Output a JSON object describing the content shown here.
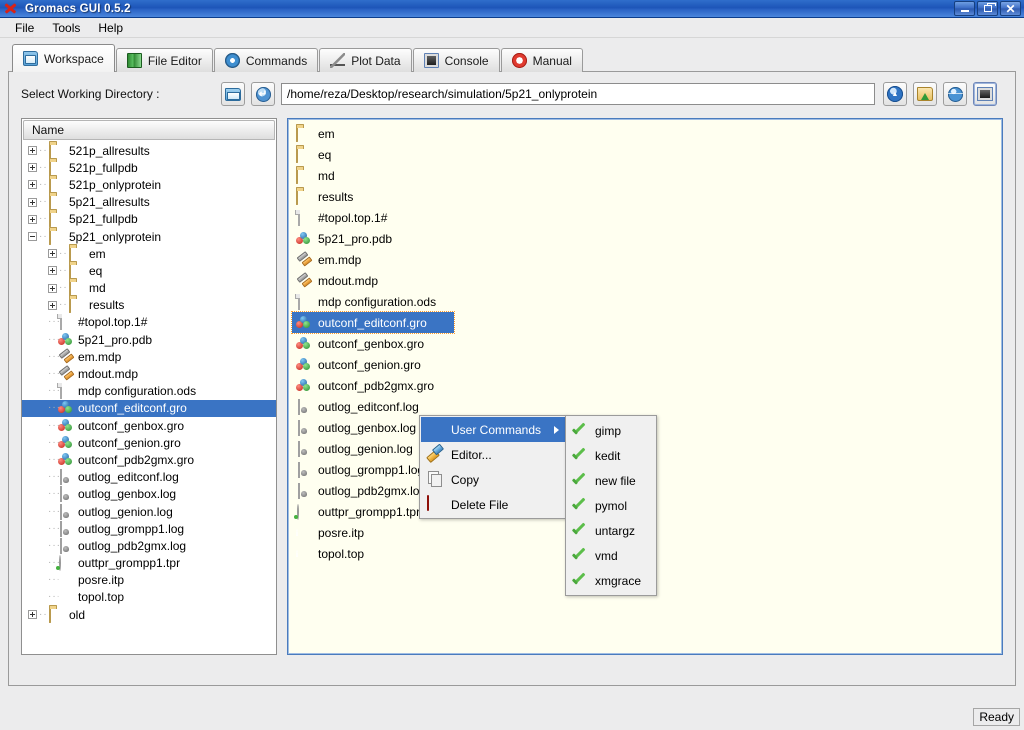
{
  "window": {
    "title": "Gromacs GUI 0.5.2",
    "logo_icon": "red-x-logo-icon",
    "controls": {
      "minimize": "minimize-button",
      "restore": "restore-button",
      "close": "close-button"
    }
  },
  "menubar": {
    "items": [
      {
        "label": "File"
      },
      {
        "label": "Tools"
      },
      {
        "label": "Help"
      }
    ]
  },
  "tabs": [
    {
      "label": "Workspace",
      "icon": "workspace-icon",
      "active": true
    },
    {
      "label": "File Editor",
      "icon": "file-editor-icon",
      "active": false
    },
    {
      "label": "Commands",
      "icon": "commands-gear-icon",
      "active": false
    },
    {
      "label": "Plot Data",
      "icon": "plot-data-icon",
      "active": false
    },
    {
      "label": "Console",
      "icon": "console-icon",
      "active": false
    },
    {
      "label": "Manual",
      "icon": "manual-lifering-icon",
      "active": false
    }
  ],
  "directory": {
    "label": "Select Working Directory :",
    "browse_icon": "open-folder-icon",
    "refresh_icon": "refresh-icon",
    "path": "/home/reza/Desktop/research/simulation/5p21_onlyprotein",
    "path_placeholder": "",
    "actions": [
      {
        "icon": "globe-up-icon"
      },
      {
        "icon": "folder-green-arrow-icon"
      },
      {
        "icon": "globe-icon"
      },
      {
        "icon": "terminal-icon"
      }
    ]
  },
  "tree": {
    "header": "Name",
    "items": [
      {
        "label": "521p_allresults",
        "depth": 0,
        "icon": "folder",
        "expander": "plus",
        "selected": false
      },
      {
        "label": "521p_fullpdb",
        "depth": 0,
        "icon": "folder",
        "expander": "plus",
        "selected": false
      },
      {
        "label": "521p_onlyprotein",
        "depth": 0,
        "icon": "folder",
        "expander": "plus",
        "selected": false
      },
      {
        "label": "5p21_allresults",
        "depth": 0,
        "icon": "folder",
        "expander": "plus",
        "selected": false
      },
      {
        "label": "5p21_fullpdb",
        "depth": 0,
        "icon": "folder",
        "expander": "plus",
        "selected": false
      },
      {
        "label": "5p21_onlyprotein",
        "depth": 0,
        "icon": "folder",
        "expander": "minus",
        "selected": false
      },
      {
        "label": "em",
        "depth": 1,
        "icon": "folder",
        "expander": "plus",
        "selected": false
      },
      {
        "label": "eq",
        "depth": 1,
        "icon": "folder",
        "expander": "plus",
        "selected": false
      },
      {
        "label": "md",
        "depth": 1,
        "icon": "folder",
        "expander": "plus",
        "selected": false
      },
      {
        "label": "results",
        "depth": 1,
        "icon": "folder",
        "expander": "plus",
        "selected": false
      },
      {
        "label": "#topol.top.1#",
        "depth": 1,
        "icon": "doc",
        "expander": "none",
        "selected": false
      },
      {
        "label": "5p21_pro.pdb",
        "depth": 1,
        "icon": "mol",
        "expander": "none",
        "selected": false
      },
      {
        "label": "em.mdp",
        "depth": 1,
        "icon": "mdp",
        "expander": "none",
        "selected": false
      },
      {
        "label": "mdout.mdp",
        "depth": 1,
        "icon": "mdp",
        "expander": "none",
        "selected": false
      },
      {
        "label": "mdp configuration.ods",
        "depth": 1,
        "icon": "doc",
        "expander": "none",
        "selected": false
      },
      {
        "label": "outconf_editconf.gro",
        "depth": 1,
        "icon": "mol",
        "expander": "none",
        "selected": true
      },
      {
        "label": "outconf_genbox.gro",
        "depth": 1,
        "icon": "mol",
        "expander": "none",
        "selected": false
      },
      {
        "label": "outconf_genion.gro",
        "depth": 1,
        "icon": "mol",
        "expander": "none",
        "selected": false
      },
      {
        "label": "outconf_pdb2gmx.gro",
        "depth": 1,
        "icon": "mol",
        "expander": "none",
        "selected": false
      },
      {
        "label": "outlog_editconf.log",
        "depth": 1,
        "icon": "log",
        "expander": "none",
        "selected": false
      },
      {
        "label": "outlog_genbox.log",
        "depth": 1,
        "icon": "log",
        "expander": "none",
        "selected": false
      },
      {
        "label": "outlog_genion.log",
        "depth": 1,
        "icon": "log",
        "expander": "none",
        "selected": false
      },
      {
        "label": "outlog_grompp1.log",
        "depth": 1,
        "icon": "log",
        "expander": "none",
        "selected": false
      },
      {
        "label": "outlog_pdb2gmx.log",
        "depth": 1,
        "icon": "log",
        "expander": "none",
        "selected": false
      },
      {
        "label": "outtpr_grompp1.tpr",
        "depth": 1,
        "icon": "tpr",
        "expander": "none",
        "selected": false
      },
      {
        "label": "posre.itp",
        "depth": 1,
        "icon": "itp",
        "expander": "none",
        "selected": false
      },
      {
        "label": "topol.top",
        "depth": 1,
        "icon": "itp",
        "expander": "none",
        "selected": false
      },
      {
        "label": "old",
        "depth": 0,
        "icon": "folder",
        "expander": "plus",
        "selected": false
      }
    ]
  },
  "filelist": {
    "items": [
      {
        "label": "em",
        "icon": "folder",
        "selected": false
      },
      {
        "label": "eq",
        "icon": "folder",
        "selected": false
      },
      {
        "label": "md",
        "icon": "folder",
        "selected": false
      },
      {
        "label": "results",
        "icon": "folder",
        "selected": false
      },
      {
        "label": "#topol.top.1#",
        "icon": "doc",
        "selected": false
      },
      {
        "label": "5p21_pro.pdb",
        "icon": "mol",
        "selected": false
      },
      {
        "label": "em.mdp",
        "icon": "mdp",
        "selected": false
      },
      {
        "label": "mdout.mdp",
        "icon": "mdp",
        "selected": false
      },
      {
        "label": "mdp configuration.ods",
        "icon": "doc",
        "selected": false
      },
      {
        "label": "outconf_editconf.gro",
        "icon": "mol",
        "selected": true
      },
      {
        "label": "outconf_genbox.gro",
        "icon": "mol",
        "selected": false
      },
      {
        "label": "outconf_genion.gro",
        "icon": "mol",
        "selected": false
      },
      {
        "label": "outconf_pdb2gmx.gro",
        "icon": "mol",
        "selected": false
      },
      {
        "label": "outlog_editconf.log",
        "icon": "log",
        "selected": false
      },
      {
        "label": "outlog_genbox.log",
        "icon": "log",
        "selected": false
      },
      {
        "label": "outlog_genion.log",
        "icon": "log",
        "selected": false
      },
      {
        "label": "outlog_grompp1.log",
        "icon": "log",
        "selected": false
      },
      {
        "label": "outlog_pdb2gmx.log",
        "icon": "log",
        "selected": false
      },
      {
        "label": "outtpr_grompp1.tpr",
        "icon": "tpr",
        "selected": false
      },
      {
        "label": "posre.itp",
        "icon": "itp",
        "selected": false
      },
      {
        "label": "topol.top",
        "icon": "itp",
        "selected": false
      }
    ]
  },
  "context_menu": {
    "items": [
      {
        "label": "User Commands",
        "icon": "green-plus-icon",
        "highlighted": true,
        "has_submenu": true
      },
      {
        "label": "Editor...",
        "icon": "edit-pencil-icon",
        "highlighted": false,
        "has_submenu": false
      },
      {
        "label": "Copy",
        "icon": "copy-icon",
        "highlighted": false,
        "has_submenu": false
      },
      {
        "label": "Delete File",
        "icon": "delete-minus-icon",
        "highlighted": false,
        "has_submenu": false
      }
    ]
  },
  "submenu": {
    "items": [
      {
        "label": "gimp",
        "icon": "check-icon"
      },
      {
        "label": "kedit",
        "icon": "check-icon"
      },
      {
        "label": "new file",
        "icon": "check-icon"
      },
      {
        "label": "pymol",
        "icon": "check-icon"
      },
      {
        "label": "untargz",
        "icon": "check-icon"
      },
      {
        "label": "vmd",
        "icon": "check-icon"
      },
      {
        "label": "xmgrace",
        "icon": "check-icon"
      }
    ]
  },
  "statusbar": {
    "text": "Ready"
  },
  "colors": {
    "titlebar_blue": "#1d55b8",
    "selection_blue": "#3a74c4",
    "list_background": "#fffff0",
    "panel_gray": "#ececed",
    "focus_orange": "#ff9a2e",
    "check_green": "#5cbe4a"
  }
}
